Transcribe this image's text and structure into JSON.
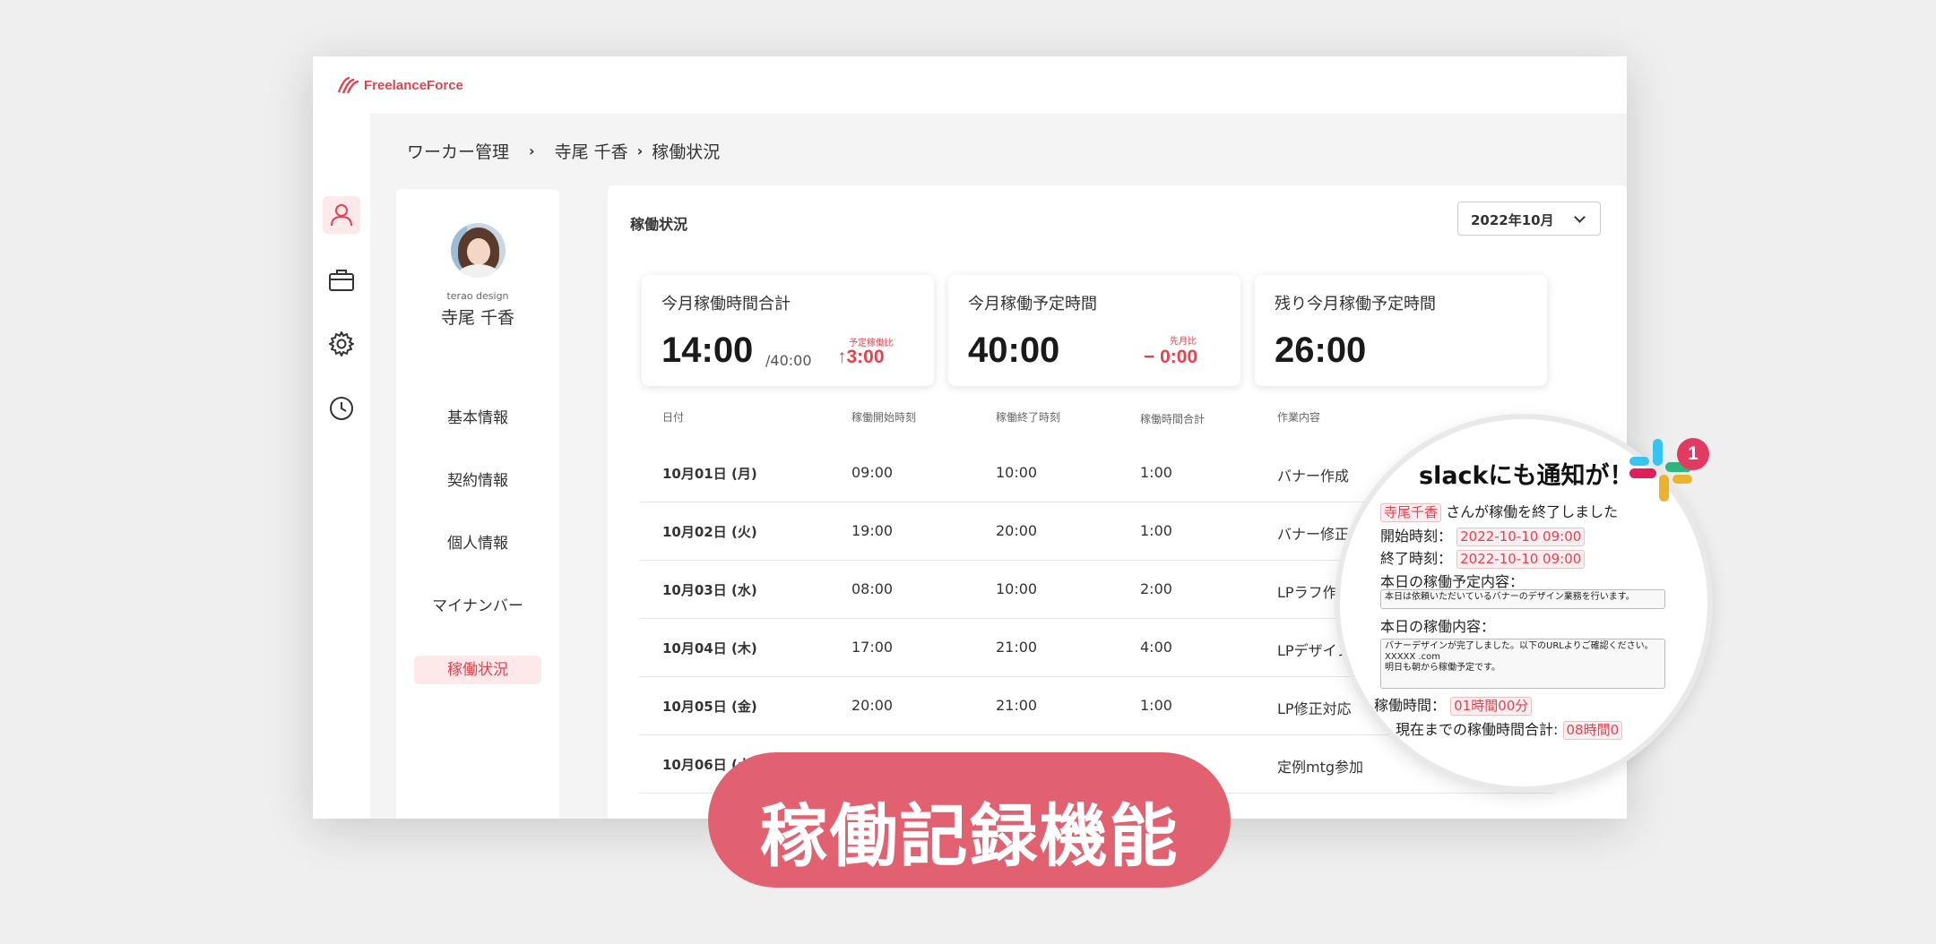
{
  "app": {
    "logo_text": "FreelanceForce"
  },
  "breadcrumb": {
    "item1": "ワーカー管理",
    "sep1": "›",
    "item2": "寺尾 千香",
    "sep2": "›",
    "item3": "稼働状況"
  },
  "profile": {
    "company": "terao design",
    "name": "寺尾 千香",
    "menu": [
      "基本情報",
      "契約情報",
      "個人情報",
      "マイナンバー",
      "稼働状況"
    ]
  },
  "main": {
    "title": "稼働状況",
    "month": "2022年10月"
  },
  "stats": [
    {
      "label": "今月稼働時間合計",
      "value": "14:00",
      "sub": "/40:00",
      "delta_label": "予定稼働比",
      "delta": "↑3:00"
    },
    {
      "label": "今月稼働予定時間",
      "value": "40:00",
      "delta_label": "先月比",
      "delta": "− 0:00"
    },
    {
      "label": "残り今月稼働予定時間",
      "value": "26:00"
    }
  ],
  "table": {
    "headers": [
      "日付",
      "稼働開始時刻",
      "稼働終了時刻",
      "稼働時間合計",
      "作業内容"
    ],
    "rows": [
      {
        "date": "10月01日 (月)",
        "start": "09:00",
        "end": "10:00",
        "total": "1:00",
        "task": "バナー作成"
      },
      {
        "date": "10月02日 (火)",
        "start": "19:00",
        "end": "20:00",
        "total": "1:00",
        "task": "バナー修正"
      },
      {
        "date": "10月03日 (水)",
        "start": "08:00",
        "end": "10:00",
        "total": "2:00",
        "task": "LPラフ作"
      },
      {
        "date": "10月04日 (木)",
        "start": "17:00",
        "end": "21:00",
        "total": "4:00",
        "task": "LPデザイン"
      },
      {
        "date": "10月05日 (金)",
        "start": "20:00",
        "end": "21:00",
        "total": "1:00",
        "task": "LP修正対応"
      },
      {
        "date": "10月06日 (土)",
        "start": "",
        "end": "",
        "total": "",
        "task": "定例mtg参加"
      }
    ]
  },
  "banner": {
    "text": "稼働記録機能"
  },
  "slack": {
    "title": "slackにも通知が！",
    "badge": "1",
    "user": "寺尾千香",
    "msg": "さんが稼働を終了しました",
    "start_label": "開始時刻：",
    "start_value": "2022-10-10 09:00",
    "end_label": "終了時刻：",
    "end_value": "2022-10-10 09:00",
    "plan_label": "本日の稼働予定内容：",
    "plan_text": "本日は依頼いただいているバナーのデザイン業務を行います。",
    "work_label": "本日の稼働内容：",
    "work_line1": "バナーデザインが完了しました。以下のURLよりご確認ください。",
    "work_line2": "XXXXX .com",
    "work_line3": "明日も朝から稼働予定です。",
    "hours_label": "稼働時間：",
    "hours_value": "01時間00分",
    "total_label": "現在までの稼働時間合計:",
    "total_value": "08時間0"
  },
  "colors": {
    "accent": "#e5424f",
    "banner": "#e26170",
    "active_bg": "#fde8ea"
  }
}
